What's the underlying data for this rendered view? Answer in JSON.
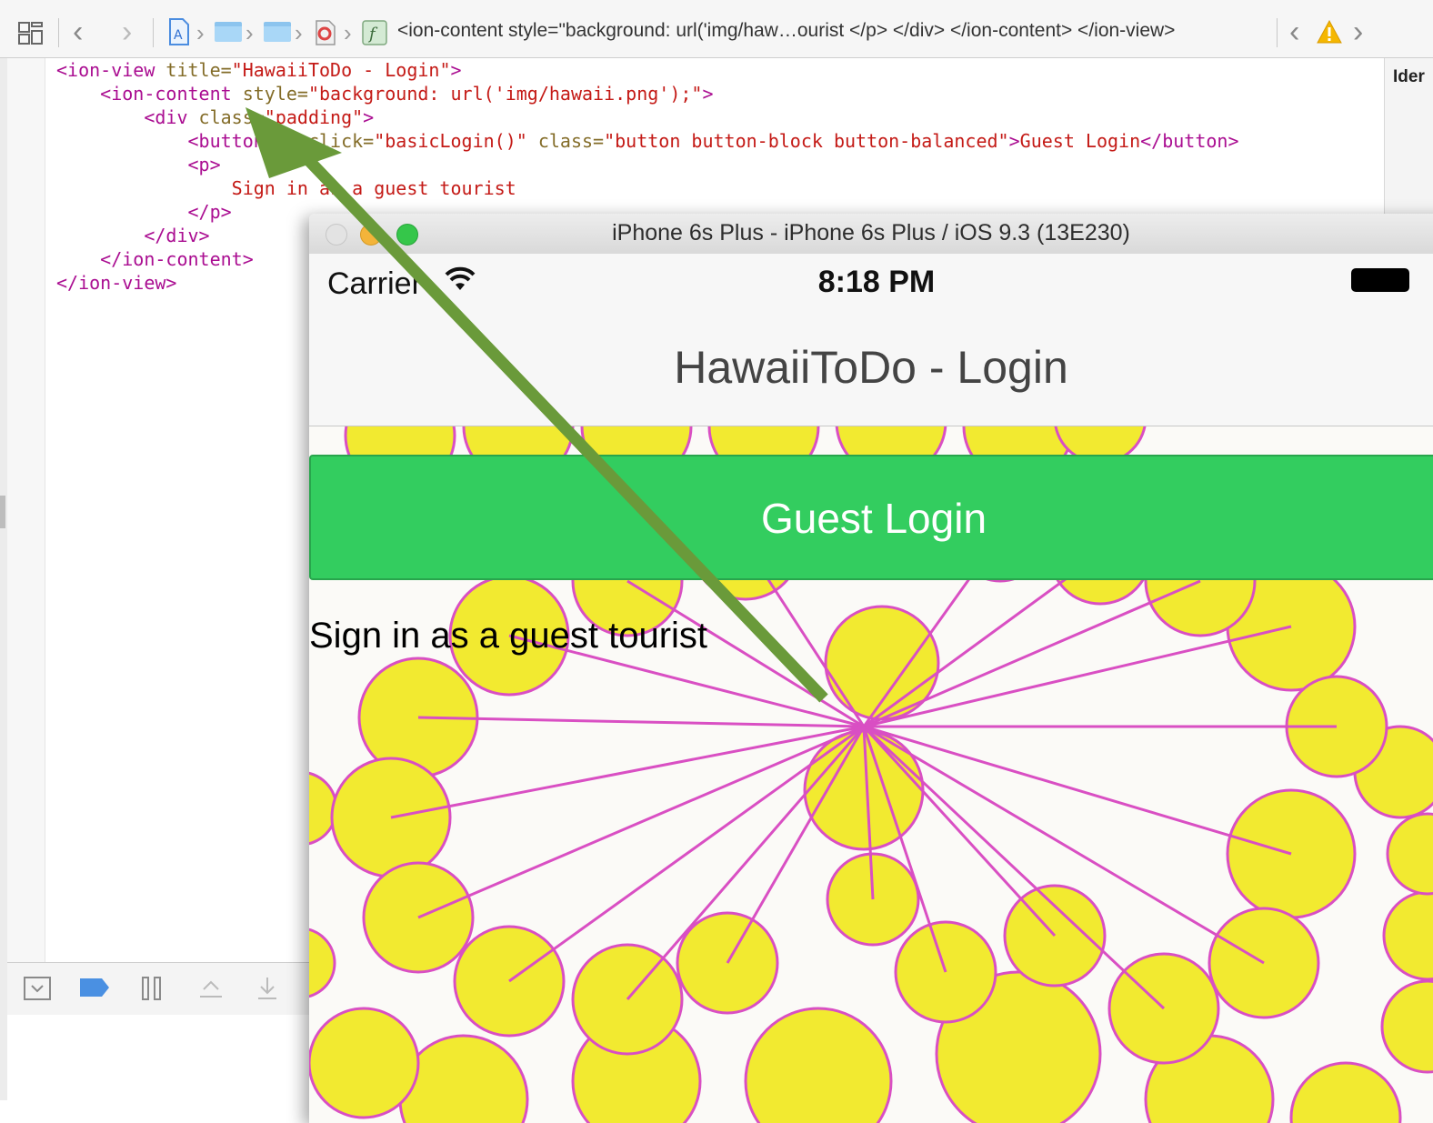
{
  "jumpbar": {
    "path_text": "<ion-content style=\"background: url('img/haw…ourist </p> </div> </ion-content> </ion-view>",
    "warning_icon": "warning-triangle-icon",
    "colors": {
      "folder": "#a9d7f7",
      "warning": "#f5b700"
    }
  },
  "inspector": {
    "title": "Ider"
  },
  "editor": {
    "lines": [
      {
        "t1": "<ion-view ",
        "a1": "title=",
        "s1": "\"HawaiiToDo - Login\"",
        "t2": ">"
      },
      {
        "t1": "<ion-content ",
        "a1": "style=",
        "s1": "\"background: url('img/hawaii.png');\"",
        "t2": ">"
      },
      {
        "t1": "<div ",
        "a1": "class=",
        "s1": "\"padding\"",
        "t2": ">"
      },
      {
        "t1": "<button ",
        "a1": "ng-click=",
        "s1": "\"basicLogin()\"",
        "a2": " class=",
        "s2": "\"button button-block button-balanced\"",
        "t2": ">",
        "text": "Guest Login",
        "t3": "</button>"
      },
      {
        "t1": "<p>"
      },
      {
        "text": "Sign in as a guest tourist"
      },
      {
        "t1": "</p>"
      },
      {
        "t1": "</div>"
      },
      {
        "t1": "</ion-content>"
      },
      {
        "t1": "</ion-view>"
      }
    ]
  },
  "simulator": {
    "window_title": "iPhone 6s Plus - iPhone 6s Plus / iOS 9.3 (13E230)",
    "status": {
      "carrier": "Carrier",
      "time": "8:18 PM"
    },
    "nav_title": "HawaiiToDo - Login",
    "guest_button": "Guest Login",
    "sign_text": "Sign in as a guest tourist",
    "colors": {
      "button": "#33cd5f",
      "flower_fill": "#f2ea30",
      "flower_stroke": "#d94fc3"
    }
  },
  "annotation": {
    "arrow_color": "#6a9a3a"
  }
}
